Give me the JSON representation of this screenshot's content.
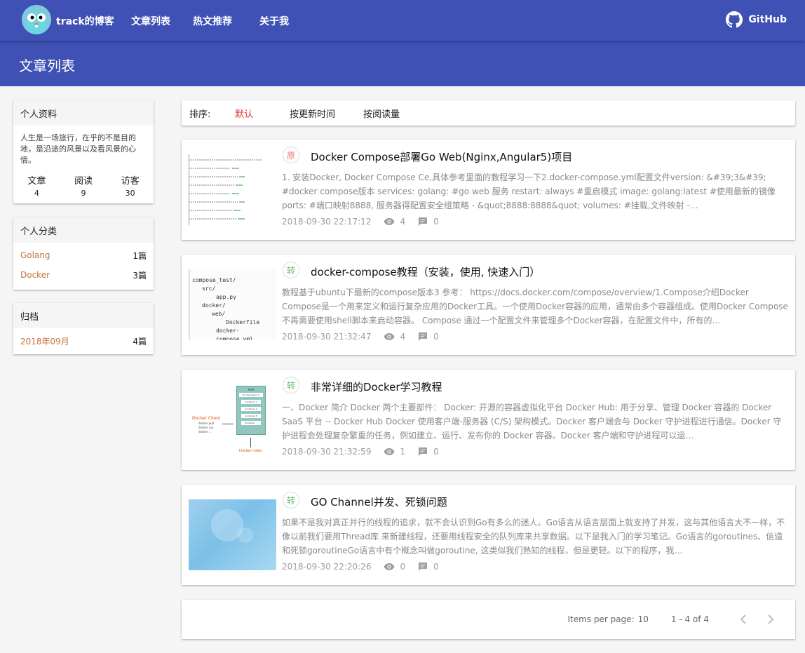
{
  "topbar": {
    "site_name": "track的博客",
    "nav": [
      "文章列表",
      "热文推荐",
      "关于我"
    ],
    "github_label": "GitHub"
  },
  "banner": {
    "title": "文章列表"
  },
  "profile": {
    "title": "个人资料",
    "bio": "人生是一场旅行，在乎的不是目的地，是沿途的风景以及看风景的心情。",
    "stats": [
      {
        "label": "文章",
        "value": "4"
      },
      {
        "label": "阅读",
        "value": "9"
      },
      {
        "label": "访客",
        "value": "30"
      }
    ]
  },
  "categories": {
    "title": "个人分类",
    "items": [
      {
        "name": "Golang",
        "count": "1篇"
      },
      {
        "name": "Docker",
        "count": "3篇"
      }
    ]
  },
  "archive": {
    "title": "归档",
    "items": [
      {
        "name": "2018年09月",
        "count": "4篇"
      }
    ]
  },
  "sort": {
    "label": "排序:",
    "options": [
      "默认",
      "按更新时间",
      "按阅读量"
    ],
    "active_color": "#e53935"
  },
  "articles": [
    {
      "badge": "原",
      "badge_color": "#e57373",
      "title": "Docker Compose部署Go Web(Nginx,Angular5)项目",
      "summary": "1. 安装Docker, Docker Compose Ce,具体参考里面的教程学习一下2.docker-compose.yml配置文件version: &#39;3&#39; #docker compose版本 services:   golang:    #go web 服务    restart: always    #重启模式    image: golang:latest #使用最新的镜像     ports:  #端口映射8888, 服务器得配置安全组策略      - &quot;8888:8888&quot;     volumes:  #挂载,文件映射     -…",
      "date": "2018-09-30 22:17:12",
      "views": "4",
      "comments": "0"
    },
    {
      "badge": "转",
      "badge_color": "#66bb6a",
      "title": "docker-compose教程（安装，使用, 快速入门）",
      "summary": "教程基于ubuntu下最新的compose版本3 参考： https://docs.docker.com/compose/overview/1.Compose介绍Docker Compose是一个用来定义和运行复杂应用的Docker工具。一个使用Docker容器的应用，通常由多个容器组成。使用Docker Compose不再需要使用shell脚本来启动容器。 Compose 通过一个配置文件来管理多个Docker容器，在配置文件中，所有的…",
      "date": "2018-09-30 21:32:47",
      "views": "4",
      "comments": "0"
    },
    {
      "badge": "转",
      "badge_color": "#66bb6a",
      "title": "非常详细的Docker学习教程",
      "summary": "一、Docker 简介 Docker 两个主要部件： Docker: 开源的容器虚拟化平台 Docker Hub: 用于分享、管理 Docker 容器的 Docker SaaS 平台 -- Docker Hub Docker 使用客户端-服务器 (C/S) 架构模式。Docker 客户端会与 Docker 守护进程进行通信。Docker 守护进程会处理复杂繁重的任务，例如建立、运行、发布你的 Docker 容器。Docker 客户端和守护进程可以运…",
      "date": "2018-09-30 21:32:59",
      "views": "1",
      "comments": "0"
    },
    {
      "badge": "转",
      "badge_color": "#66bb6a",
      "title": "GO Channel并发、死锁问题",
      "summary": "如果不是我对真正并行的线程的追求，就不会认识到Go有多么的迷人。Go语言从语言层面上就支持了并发，这与其他语言大不一样，不像以前我们要用Thread库 来新建线程，还要用线程安全的队列库来共享数据。以下是我入门的学习笔记。Go语言的goroutines、信道和死锁goroutineGo语言中有个概念叫做goroutine, 这类似我们熟知的线程，但是更轻。以下的程序，我…",
      "date": "2018-09-30 22:20:26",
      "views": "0",
      "comments": "0"
    }
  ],
  "thumb2_lines": [
    "compose_test/",
    "src/",
    "app.py",
    "docker/",
    "web/",
    "Dockerfile",
    "docker-compose.yml"
  ],
  "thumb3": {
    "client": "Docker Client",
    "client_items": [
      "docker pull",
      "docker run",
      "docker ..."
    ],
    "host": "Host",
    "host_items": [
      "Docker Daemon",
      "Container 1",
      "Container 2",
      "Container N",
      "Container ..."
    ],
    "registry": "Docker Index"
  },
  "pagination": {
    "items_per_page_label": "Items per page:",
    "items_per_page": "10",
    "range": "1 - 4 of 4"
  }
}
